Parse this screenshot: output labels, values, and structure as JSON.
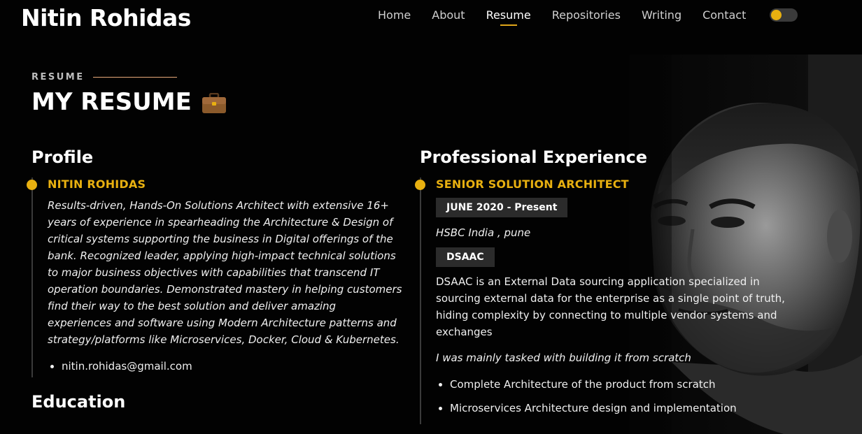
{
  "header": {
    "brand": "Nitin Rohidas",
    "nav": [
      "Home",
      "About",
      "Resume",
      "Repositories",
      "Writing",
      "Contact"
    ],
    "active_nav": "Resume",
    "theme_toggle_on": false
  },
  "section": {
    "eyebrow": "RESUME",
    "title": "MY RESUME",
    "title_icon": "briefcase-icon"
  },
  "profile": {
    "heading": "Profile",
    "name": "NITIN ROHIDAS",
    "summary": "Results-driven, Hands-On Solutions Architect with extensive 16+ years of experience in spearheading the Architecture & Design of critical systems supporting the business in Digital offerings of the bank. Recognized leader, applying high-impact technical solutions to major business objectives with capabilities that transcend IT operation boundaries. Demonstrated mastery in helping customers find their way to the best solution and deliver amazing experiences and software using Modern Architecture patterns and strategy/platforms like Microservices, Docker, Cloud & Kubernetes.",
    "contacts": [
      "nitin.rohidas@gmail.com"
    ]
  },
  "education": {
    "heading": "Education"
  },
  "experience": {
    "heading": "Professional Experience",
    "role": "SENIOR SOLUTION ARCHITECT",
    "period": "JUNE 2020 - Present",
    "company": "HSBC India , pune",
    "project": "DSAAC",
    "description": "DSAAC is an External Data sourcing application specialized in sourcing external data for the enterprise as a single point of truth, hiding complexity by connecting to multiple vendor systems and exchanges",
    "note": "I was mainly tasked with building it from scratch",
    "items": [
      "Complete Architecture of the product from scratch",
      "Microservices Architecture design and implementation"
    ]
  },
  "colors": {
    "accent": "#e8b010",
    "background": "#020202",
    "tag_bg": "#2b2b2b"
  }
}
